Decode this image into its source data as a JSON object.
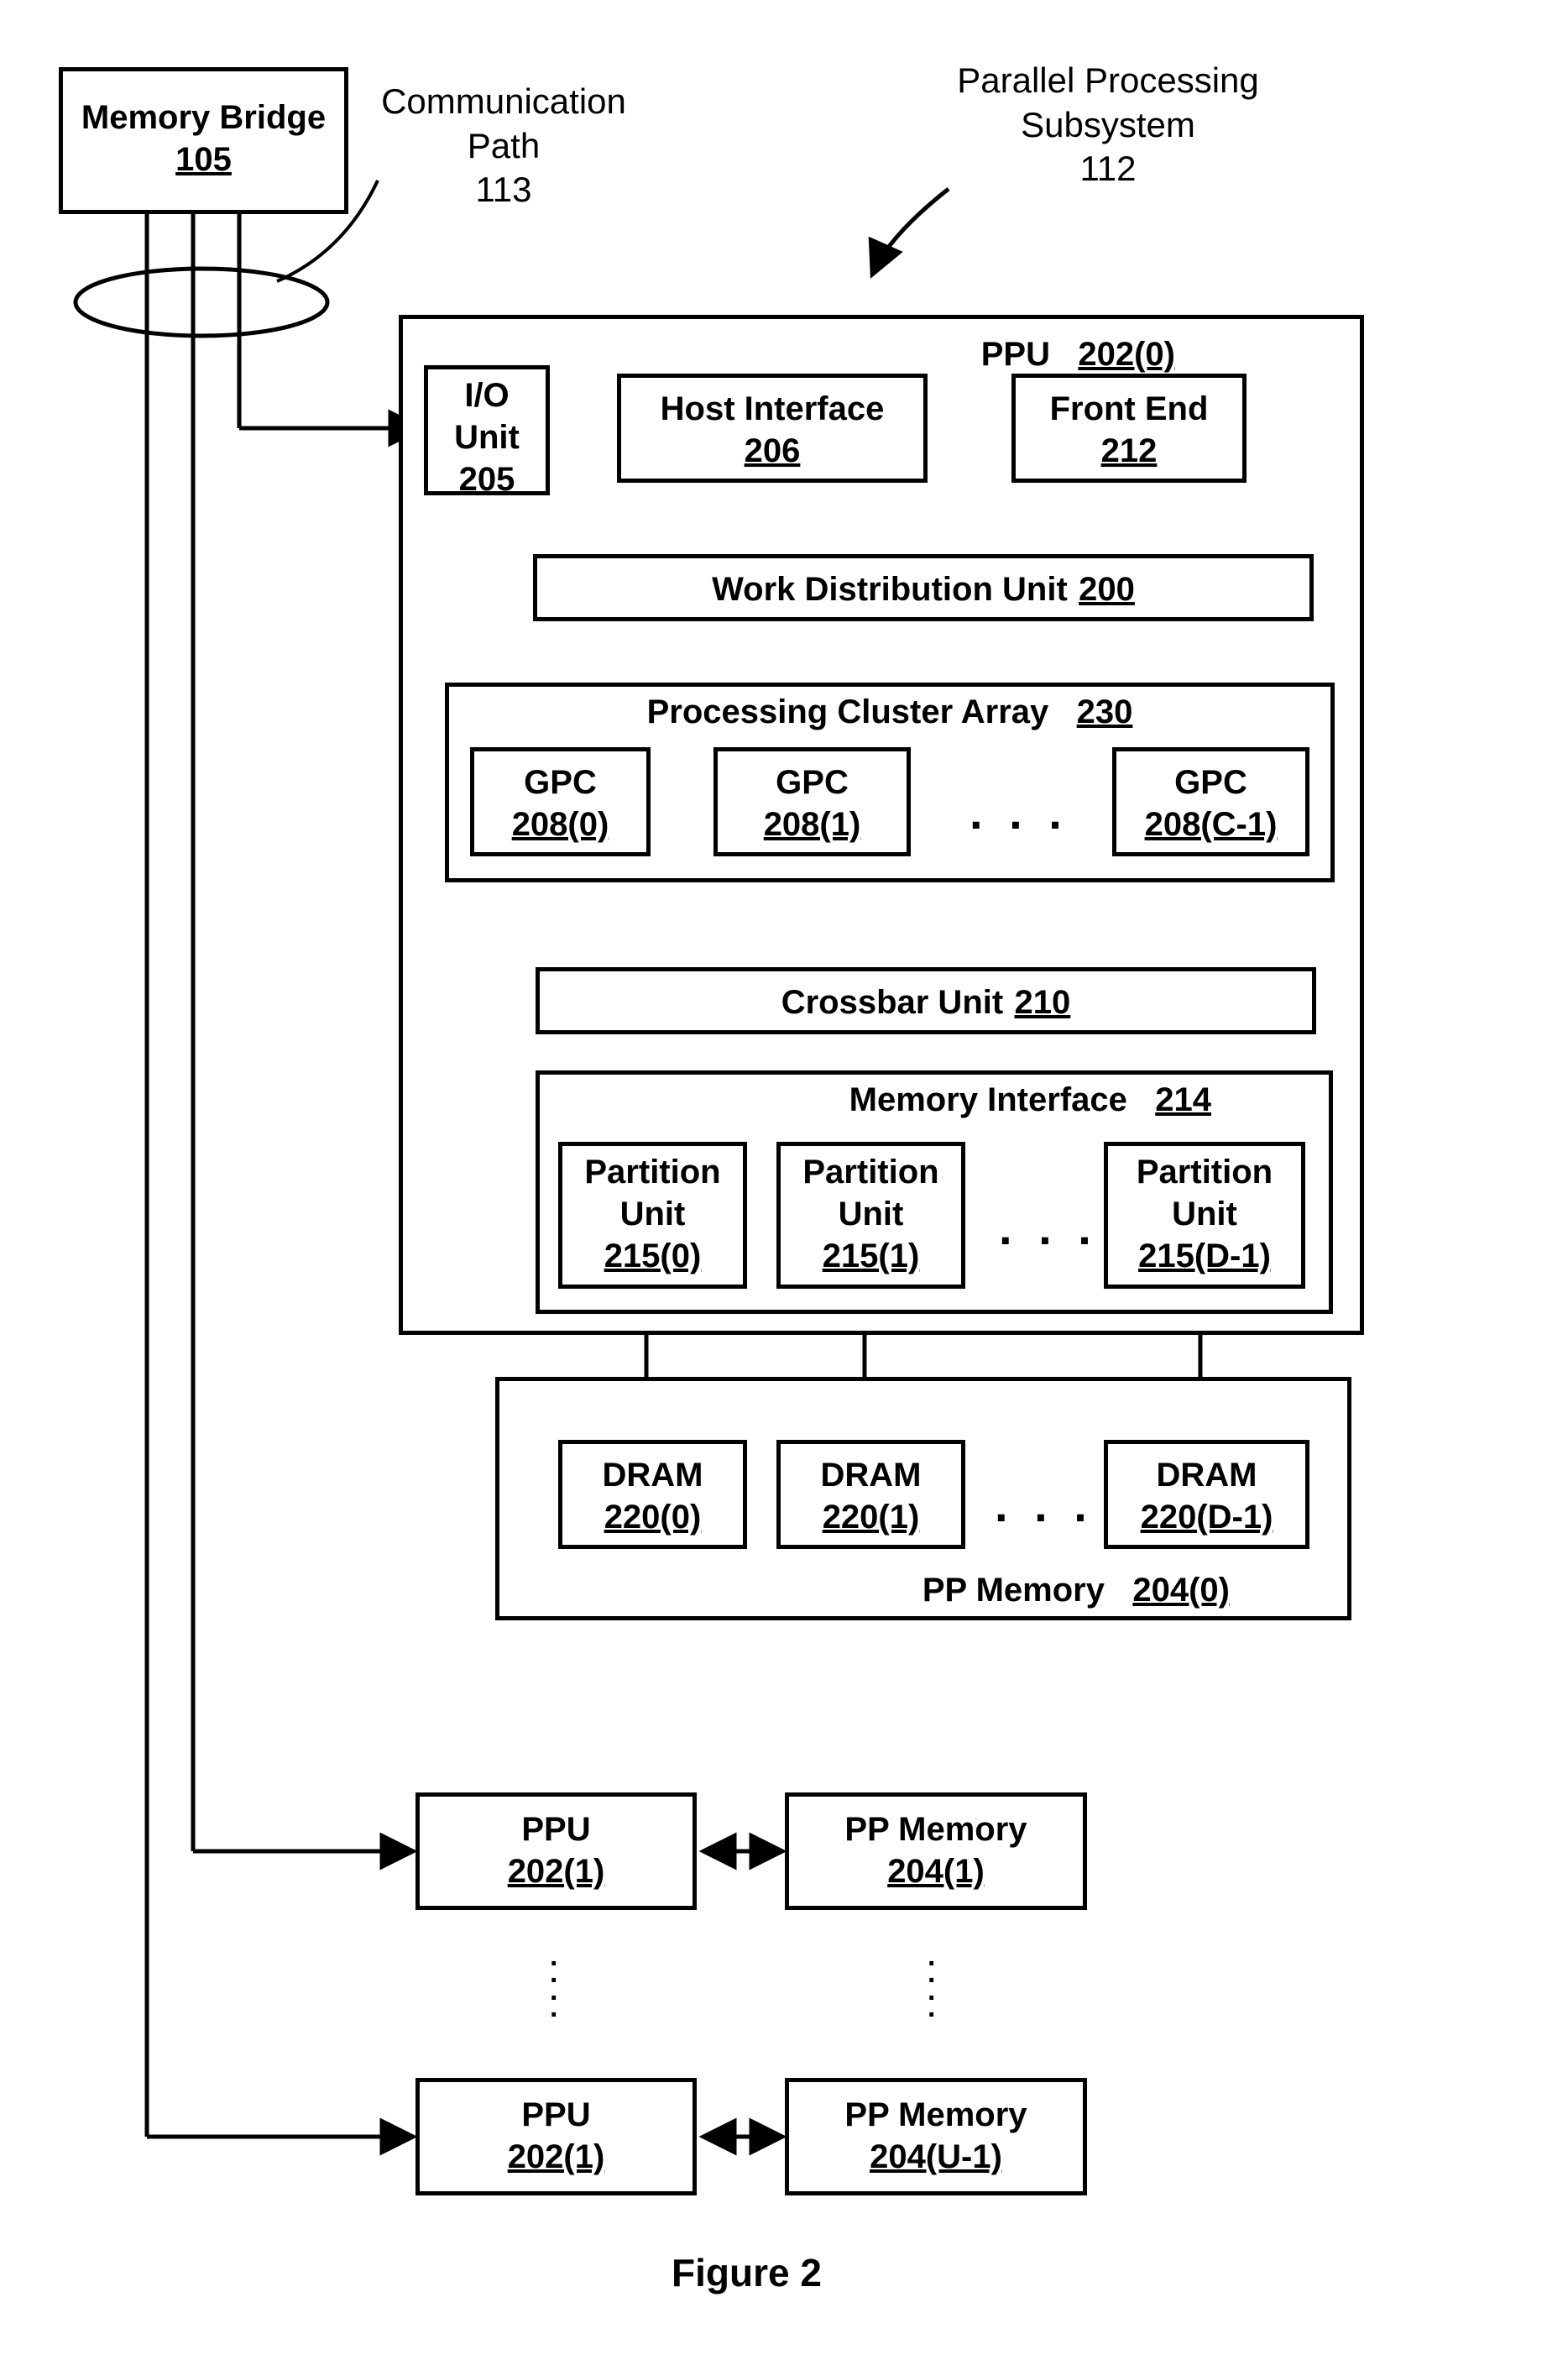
{
  "labels": {
    "memory_bridge": "Memory Bridge",
    "memory_bridge_ref": "105",
    "communication_path": "Communication",
    "communication_path2": "Path",
    "communication_path_ref": "113",
    "pps": "Parallel Processing",
    "pps2": "Subsystem",
    "pps_ref": "112",
    "ppu0": "PPU",
    "ppu0_ref": "202(0)",
    "io_unit": "I/O",
    "io_unit2": "Unit",
    "io_unit_ref": "205",
    "host_if": "Host Interface",
    "host_if_ref": "206",
    "front_end": "Front End",
    "front_end_ref": "212",
    "wdu": "Work Distribution Unit",
    "wdu_ref": "200",
    "pca": "Processing Cluster Array",
    "pca_ref": "230",
    "gpc": "GPC",
    "gpc0_ref": "208(0)",
    "gpc1_ref": "208(1)",
    "gpcC_ref": "208(C-1)",
    "crossbar": "Crossbar Unit",
    "crossbar_ref": "210",
    "mem_if": "Memory Interface",
    "mem_if_ref": "214",
    "part_unit": "Partition",
    "part_unit2": "Unit",
    "pu0_ref": "215(0)",
    "pu1_ref": "215(1)",
    "puD_ref": "215(D-1)",
    "dram": "DRAM",
    "dram0_ref": "220(0)",
    "dram1_ref": "220(1)",
    "dramD_ref": "220(D-1)",
    "ppmem": "PP Memory",
    "ppmem0_ref": "204(0)",
    "ppu": "PPU",
    "ppu1_ref": "202(1)",
    "ppmem_lbl": "PP Memory",
    "ppmem1_ref": "204(1)",
    "ppmemU_ref": "204(U-1)",
    "figure": "Figure 2"
  }
}
